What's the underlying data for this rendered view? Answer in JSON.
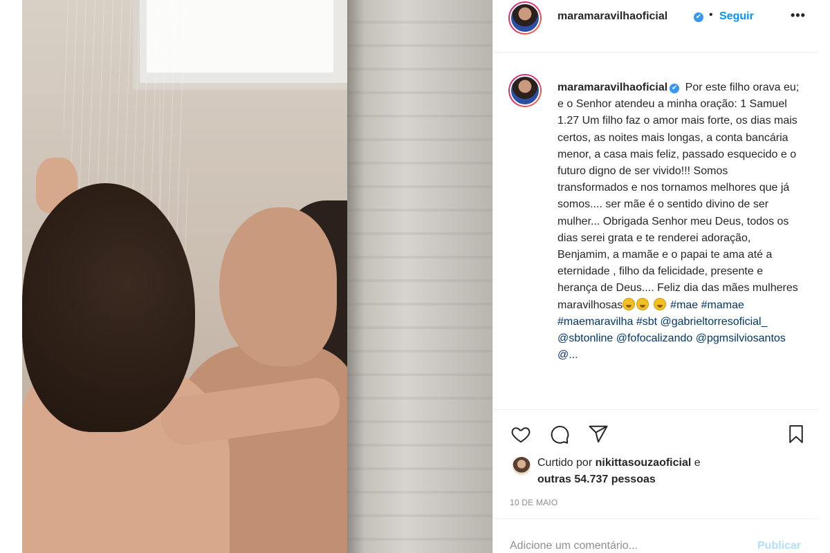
{
  "post": {
    "username": "maramaravilhaoficial",
    "separator": "•",
    "follow_label": "Seguir",
    "more_label": "•••",
    "verified_glyph": "✔",
    "image_label": "",
    "caption": {
      "username": "maramaravilhaoficial",
      "text": "Por este filho orava eu; e o Senhor atendeu a minha oração: 1 Samuel 1.27 Um filho faz o amor mais forte, os dias mais certos, as noites mais longas, a conta bancária menor, a casa mais feliz, passado esquecido e o futuro digno de ser vivido!!! Somos transformados e nos tornamos melhores que já somos.... ser mãe é o sentido divino de ser mulher... Obrigada Senhor meu Deus, todos os dias serei grata e te renderei adoração, Benjamim, a mamãe e o papai te ama até a eternidade , filho da felicidade, presente e herança de Deus.... Feliz dia das mães mulheres maravilhosas",
      "hashtags": "#mae #mamae #maemaravilha #sbt @gabrieltorresoficial_ @sbtonline @fofocalizando @pgmsilviosantos @..."
    },
    "likes": {
      "prefix": "Curtido por",
      "liker": "nikittasouzaoficial",
      "connector": "e",
      "others": "outras 54.737 pessoas"
    },
    "date": "10 DE MAIO",
    "comment": {
      "placeholder": "Adicione um comentário...",
      "value": "",
      "publish_label": "Publicar"
    }
  },
  "icons": {
    "like": "heart-icon",
    "comment": "comment-icon",
    "share": "paper-plane-icon",
    "save": "bookmark-icon"
  },
  "colors": {
    "link_blue": "#0095f6",
    "hashtag": "#00376b",
    "muted": "#8e8e8e",
    "publish_disabled": "#b2dffc",
    "verified": "#3897f0"
  }
}
